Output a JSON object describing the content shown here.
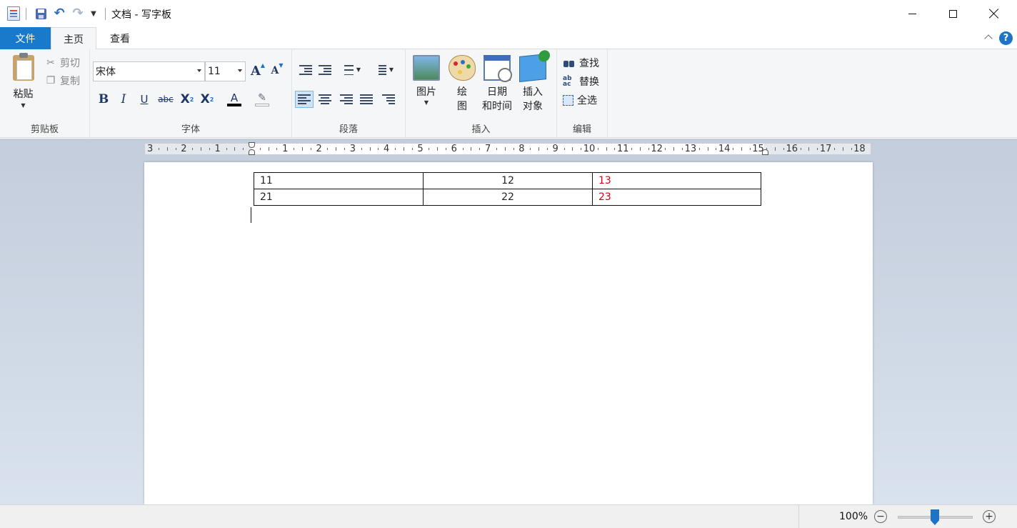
{
  "window": {
    "title": "文档 - 写字板"
  },
  "tabs": {
    "file": "文件",
    "home": "主页",
    "view": "查看"
  },
  "clipboard": {
    "group_label": "剪贴板",
    "paste": "粘贴",
    "cut": "剪切",
    "copy": "复制"
  },
  "font": {
    "group_label": "字体",
    "family": "宋体",
    "size": "11",
    "bold": "B",
    "italic": "I",
    "underline": "U",
    "strike": "abc",
    "grow": "A",
    "shrink": "A",
    "subscript": "X",
    "superscript": "X",
    "color_letter": "A"
  },
  "paragraph": {
    "group_label": "段落"
  },
  "insert": {
    "group_label": "插入",
    "picture": "图片",
    "paint_line1": "绘",
    "paint_line2": "图",
    "datetime_line1": "日期",
    "datetime_line2": "和时间",
    "object_line1": "插入",
    "object_line2": "对象"
  },
  "editing": {
    "group_label": "编辑",
    "find": "查找",
    "replace": "替换",
    "select_all": "全选"
  },
  "ruler": {
    "labels": [
      "3",
      "2",
      "1",
      "1",
      "2",
      "3",
      "4",
      "5",
      "6",
      "7",
      "8",
      "9",
      "10",
      "11",
      "12",
      "13",
      "14",
      "15",
      "16",
      "17",
      "18"
    ]
  },
  "document": {
    "table": [
      [
        "11",
        "12",
        "13"
      ],
      [
        "21",
        "22",
        "23"
      ]
    ],
    "highlight_color": "#e0000f"
  },
  "status": {
    "zoom": "100%",
    "zoom_out": "−",
    "zoom_in": "+"
  }
}
